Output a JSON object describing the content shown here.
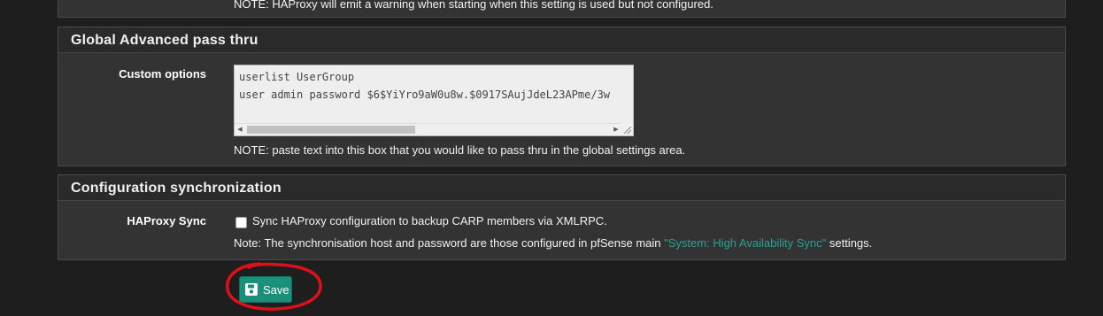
{
  "top_panel": {
    "note": "NOTE: HAProxy will emit a warning when starting when this setting is used but not configured."
  },
  "global_advanced": {
    "heading": "Global Advanced pass thru",
    "custom_options_label": "Custom options",
    "custom_options_value": "userlist UserGroup\nuser admin password $6$YiYro9aW0u8w.$0917SAujJdeL23APme/3w",
    "note": "NOTE: paste text into this box that you would like to pass thru in the global settings area."
  },
  "config_sync": {
    "heading": "Configuration synchronization",
    "haproxy_sync_label": "HAProxy Sync",
    "checkbox_label": "Sync HAProxy configuration to backup CARP members via XMLRPC.",
    "checkbox_checked": false,
    "note_prefix": "Note: The synchronisation host and password are those configured in pfSense main ",
    "note_link": "\"System: High Availability Sync\"",
    "note_suffix": " settings."
  },
  "actions": {
    "save_label": "Save",
    "save_icon": "floppy-disk-icon"
  },
  "colors": {
    "background": "#1e1e1e",
    "panel": "#333333",
    "accent": "#1a8f7a",
    "link": "#2aa198",
    "annotation": "#e0101a"
  }
}
